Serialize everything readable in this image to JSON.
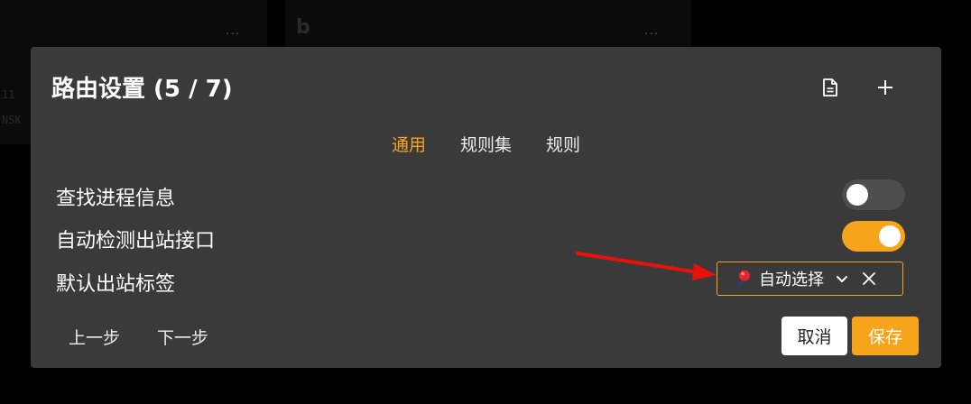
{
  "background": {
    "card1_dots": "...",
    "card2_letter": "b",
    "card2_dots": "...",
    "edge_text_1": "11",
    "edge_text_2": "NSK"
  },
  "modal": {
    "title": "路由设置 (5 / 7)",
    "icons": [
      "document-icon",
      "plus-icon"
    ],
    "tabs": [
      {
        "label": "通用",
        "active": true
      },
      {
        "label": "规则集",
        "active": false
      },
      {
        "label": "规则",
        "active": false
      }
    ],
    "settings": {
      "find_process": {
        "label": "查找进程信息",
        "enabled": false
      },
      "auto_detect_interface": {
        "label": "自动检测出站接口",
        "enabled": true
      },
      "default_outbound": {
        "label": "默认出站标签",
        "value": "自动选择"
      }
    },
    "footer": {
      "prev_label": "上一步",
      "next_label": "下一步",
      "cancel_label": "取消",
      "save_label": "保存"
    }
  },
  "colors": {
    "accent": "#f6a51a",
    "modal_bg": "#3a3a3a",
    "annotation_arrow": "#e8120c"
  }
}
